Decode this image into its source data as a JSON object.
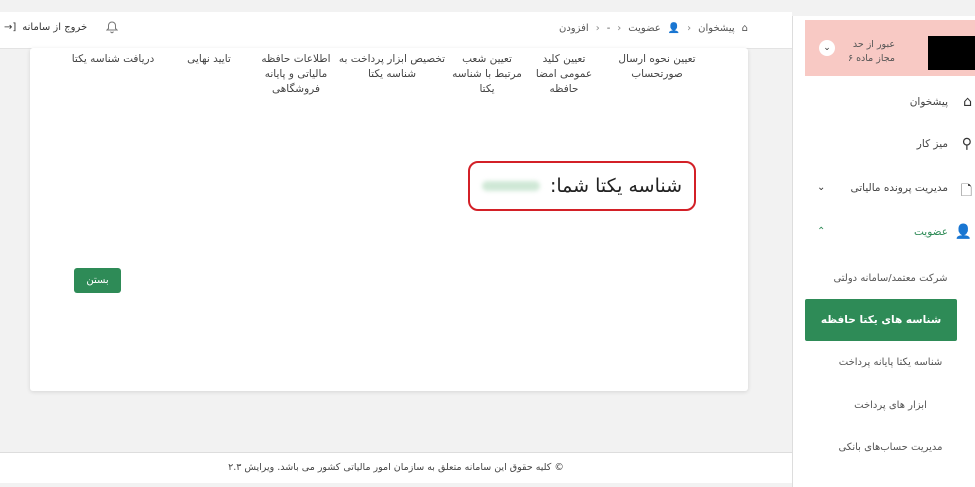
{
  "topbar": {
    "exit_label": "خروج از سامانه",
    "exit_icon": "→]",
    "bell_icon": "bell-icon",
    "breadcrumbs": [
      "پیشخوان",
      "عضویت",
      "-",
      "افزودن"
    ]
  },
  "steps": [
    "تعیین نحوه ارسال صورتحساب",
    "تعیین کلید عمومی امضا حافظه",
    "تعیین شعب مرتبط با شناسه یکتا",
    "تخصیص ابزار پرداخت به شناسه یکتا",
    "اطلاعات حافظه مالیاتی و پایانه فروشگاهی",
    "تایید نهایی",
    "دریافت شناسه یکتا"
  ],
  "result": {
    "label": "شناسه یکتا شما:"
  },
  "buttons": {
    "close": "بستن"
  },
  "footer": {
    "text": "© کلیه حقوق این سامانه متعلق به سازمان امور مالیاتی کشور می باشد. ویرایش ۲.۳"
  },
  "sidebar": {
    "alert_text": "عبور از حد مجاز ماده ۶",
    "items": [
      {
        "label": "پیشخوان",
        "icon": "⌂"
      },
      {
        "label": "میز کار",
        "icon": "⚲"
      },
      {
        "label": "مدیریت پرونده مالیاتی",
        "icon": "🗋",
        "chevron": "⌄"
      },
      {
        "label": "عضویت",
        "icon": "👤",
        "chevron": "⌃"
      }
    ],
    "subitems": [
      "شرکت معتمد/سامانه دولتی",
      "شناسه های یکتا حافظه مالیاتی",
      "شناسه یکتا پایانه پرداخت",
      "ابزار های پرداخت",
      "مدیریت حساب‌های بانکی"
    ]
  },
  "colors": {
    "accent": "#2e8b57",
    "highlight": "#d32027",
    "alert_bg": "#f8c9c4"
  }
}
